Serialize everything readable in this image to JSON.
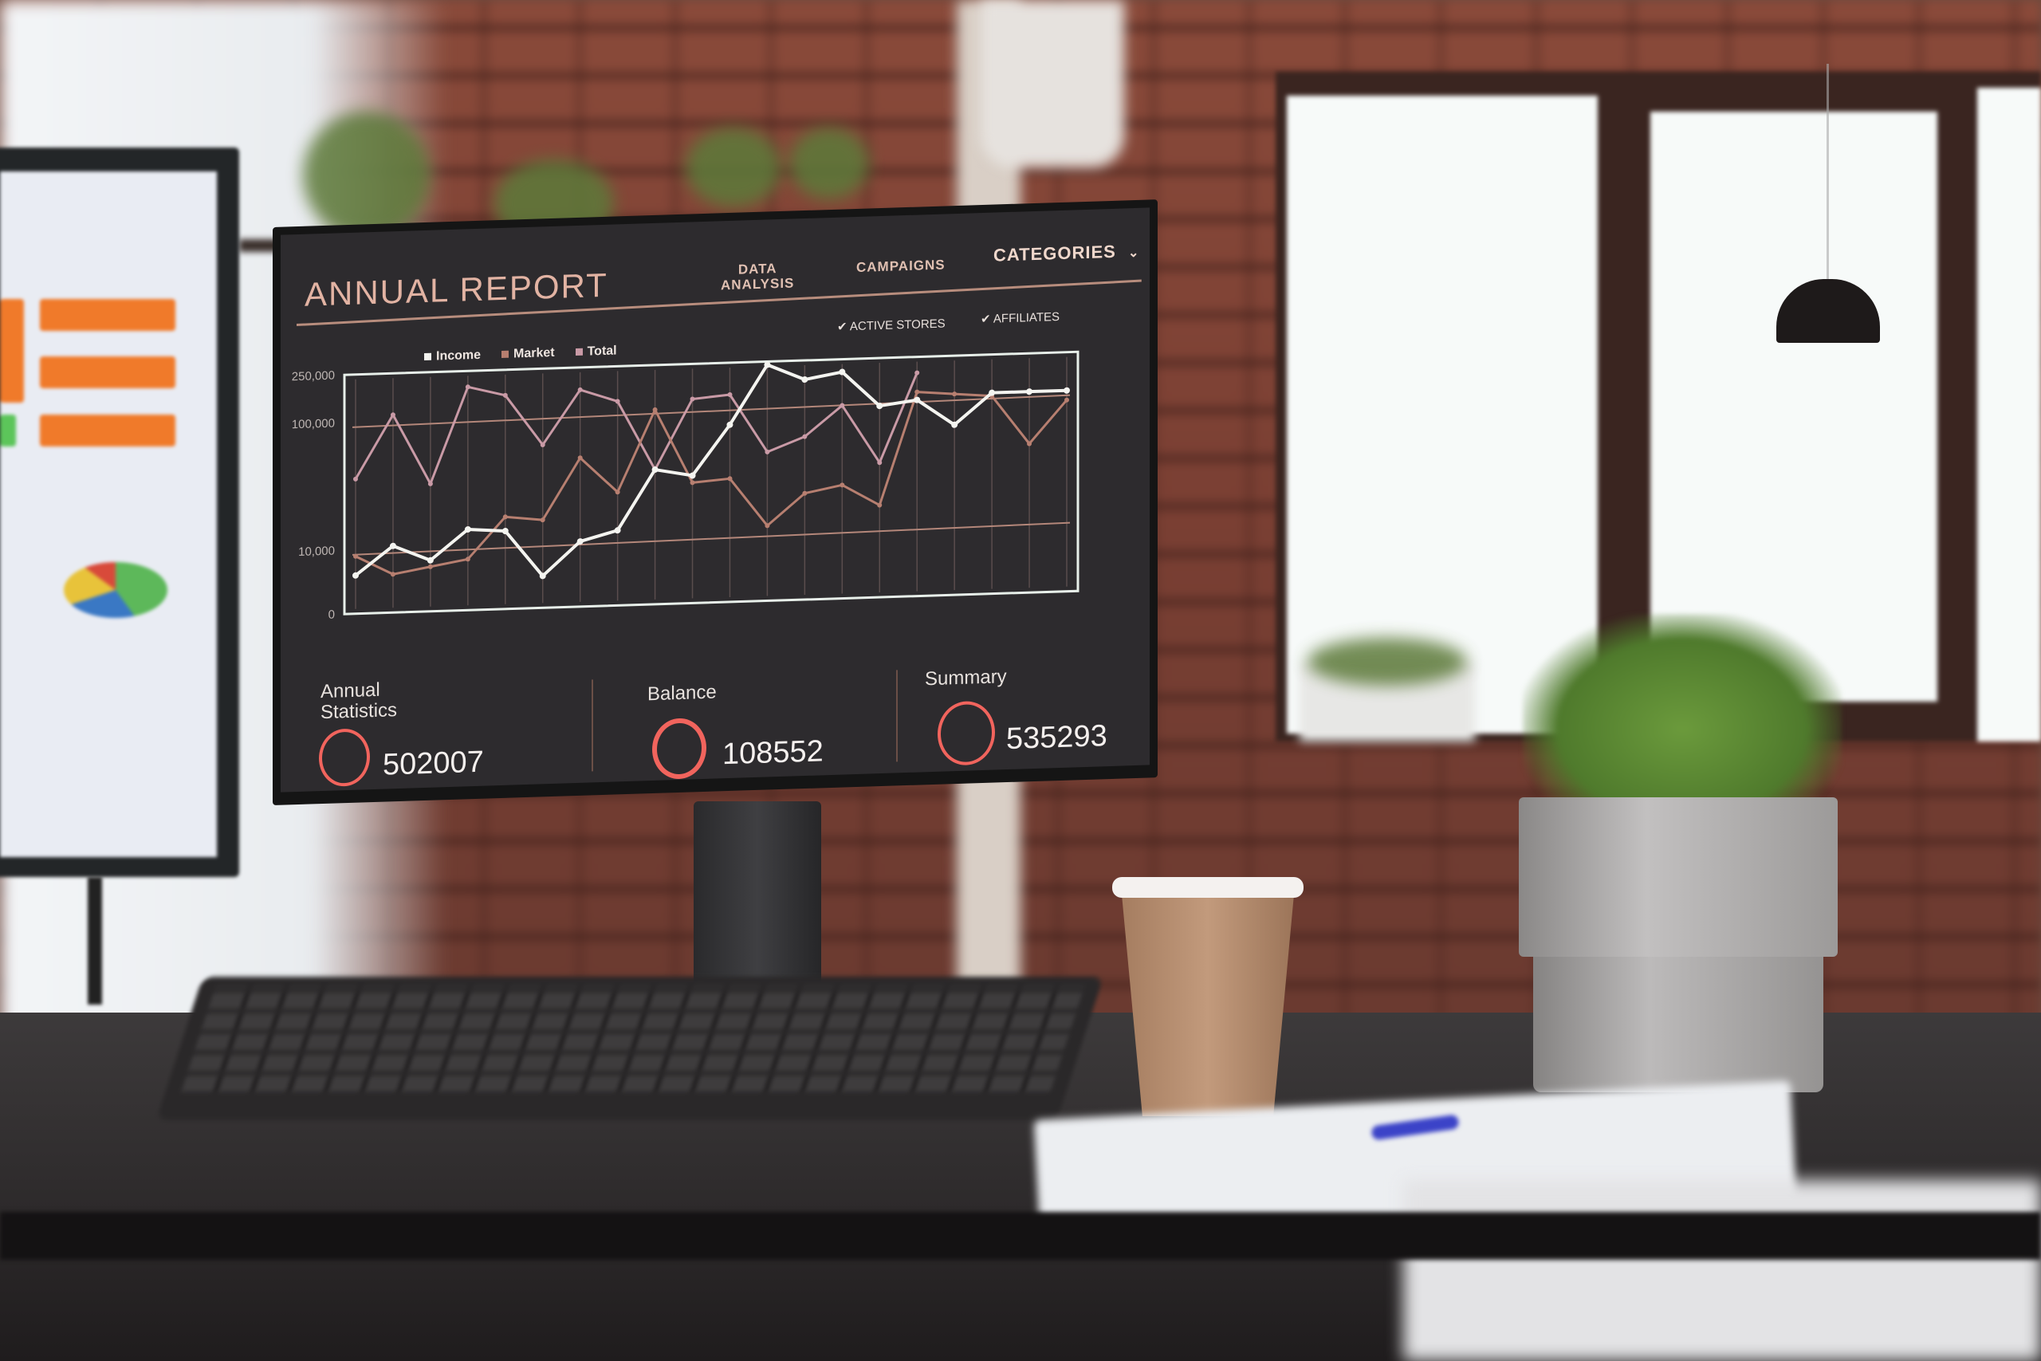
{
  "scene": {
    "description": "Office desk with monitor displaying an annual report dashboard",
    "colors": {
      "screen_bg": "#2d2b2e",
      "accent_title": "#e2b3a3",
      "ring": "#f1645d",
      "income_line": "#f4f4f0",
      "market_line": "#b77f70",
      "total_line": "#c99aa6"
    }
  },
  "dashboard": {
    "title": "ANNUAL REPORT",
    "nav": [
      {
        "label": "DATA ANALYSIS",
        "line1": "DATA",
        "line2": "ANALYSIS"
      },
      {
        "label": "CAMPAIGNS"
      },
      {
        "label": "CATEGORIES",
        "icon": "chevron-down-icon"
      }
    ],
    "filters": [
      {
        "label": "ACTIVE STORES",
        "checked": true,
        "icon": "check-icon"
      },
      {
        "label": "AFFILIATES",
        "checked": true,
        "icon": "check-icon"
      }
    ],
    "legend": [
      {
        "label": "Income",
        "color": "#f4f4f0"
      },
      {
        "label": "Market",
        "color": "#b77f70"
      },
      {
        "label": "Total",
        "color": "#c99aa6"
      }
    ],
    "stats": [
      {
        "label_line1": "Annual",
        "label_line2": "Statistics",
        "value": "502007",
        "icon": "ring-icon"
      },
      {
        "label_line1": "Balance",
        "label_line2": "",
        "value": "108552",
        "icon": "ring-icon"
      },
      {
        "label_line1": "Summary",
        "label_line2": "",
        "value": "535293",
        "icon": "ring-icon"
      }
    ]
  },
  "chart_data": {
    "type": "line",
    "title": "",
    "xlabel": "",
    "ylabel": "",
    "y_scale": "nonlinear (ticks at 0, 10,000, 100,000, 250,000)",
    "y_ticks": [
      "250,000",
      "100,000",
      "10,000",
      "0"
    ],
    "y_tick_values": [
      250000,
      100000,
      10000,
      0
    ],
    "ylim": [
      0,
      250000
    ],
    "grid": true,
    "legend_position": "top-left",
    "reference_lines": [
      10000,
      100000
    ],
    "x": [
      1,
      2,
      3,
      4,
      5,
      6,
      7,
      8,
      9,
      10,
      11,
      12,
      13,
      14,
      15,
      16,
      17,
      18,
      19,
      20
    ],
    "series": [
      {
        "name": "Income",
        "values": [
          6000,
          12000,
          8000,
          22000,
          20000,
          5000,
          11000,
          18000,
          60000,
          55000,
          90000,
          240000,
          190000,
          210000,
          100000,
          115000,
          85000,
          130000,
          130000,
          130000
        ]
      },
      {
        "name": "Market",
        "values": [
          9000,
          6000,
          7000,
          8000,
          30000,
          27000,
          70000,
          45000,
          110000,
          50000,
          52000,
          18000,
          40000,
          45000,
          30000,
          140000,
          130000,
          120000,
          70000,
          100000
        ]
      },
      {
        "name": "Total",
        "values": [
          60000,
          120000,
          55000,
          200000,
          170000,
          80000,
          180000,
          140000,
          60000,
          140000,
          150000,
          70000,
          80000,
          105000,
          60000,
          200000,
          null,
          null,
          null,
          null
        ]
      }
    ]
  }
}
